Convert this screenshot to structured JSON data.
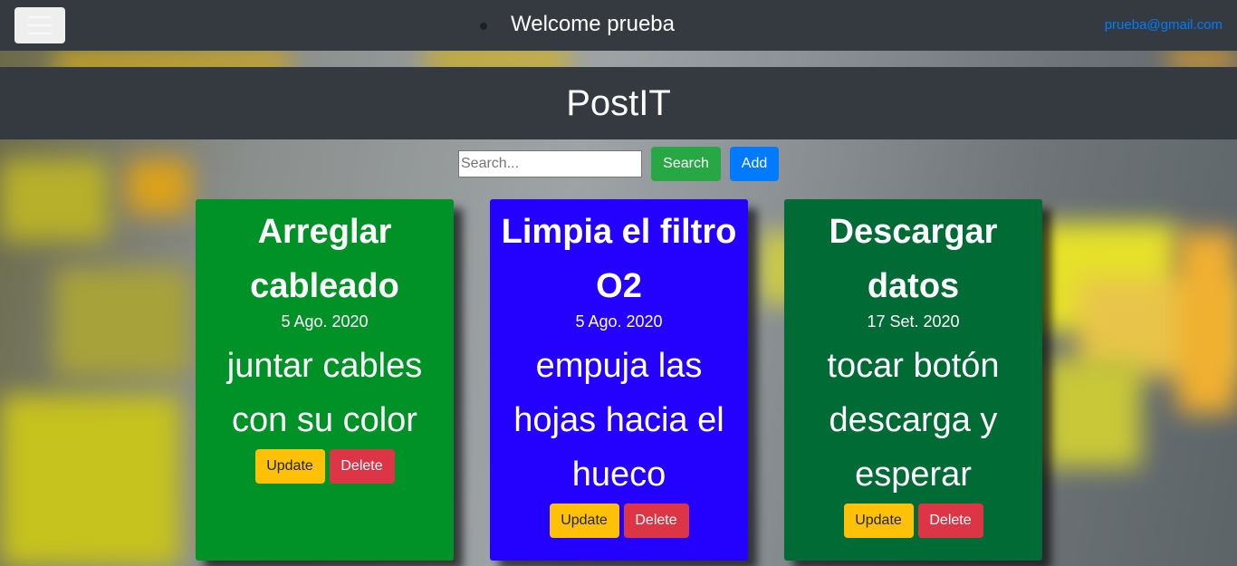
{
  "nav": {
    "welcome": "Welcome prueba",
    "email": "prueba@gmail.com",
    "menu_icon": "hamburger-icon"
  },
  "brand": {
    "title": "PostIT"
  },
  "search": {
    "placeholder": "Search...",
    "value": "",
    "search_label": "Search",
    "add_label": "Add"
  },
  "notes": [
    {
      "title": "Arreglar cableado",
      "date": "5 Ago. 2020",
      "body": "juntar cables con su color",
      "color": "#009127",
      "update_label": "Update",
      "delete_label": "Delete"
    },
    {
      "title": "Limpia el filtro O2",
      "date": "5 Ago. 2020",
      "body": "empuja las hojas hacia el hueco",
      "color": "#2400ff",
      "update_label": "Update",
      "delete_label": "Delete"
    },
    {
      "title": "Descargar datos",
      "date": "17 Set. 2020",
      "body": "tocar botón descarga y esperar",
      "color": "#006b35",
      "update_label": "Update",
      "delete_label": "Delete"
    }
  ],
  "colors": {
    "navbar": "#343a40",
    "search_button": "#28a745",
    "add_button": "#007bff",
    "update_button": "#ffc107",
    "delete_button": "#dc3545"
  }
}
